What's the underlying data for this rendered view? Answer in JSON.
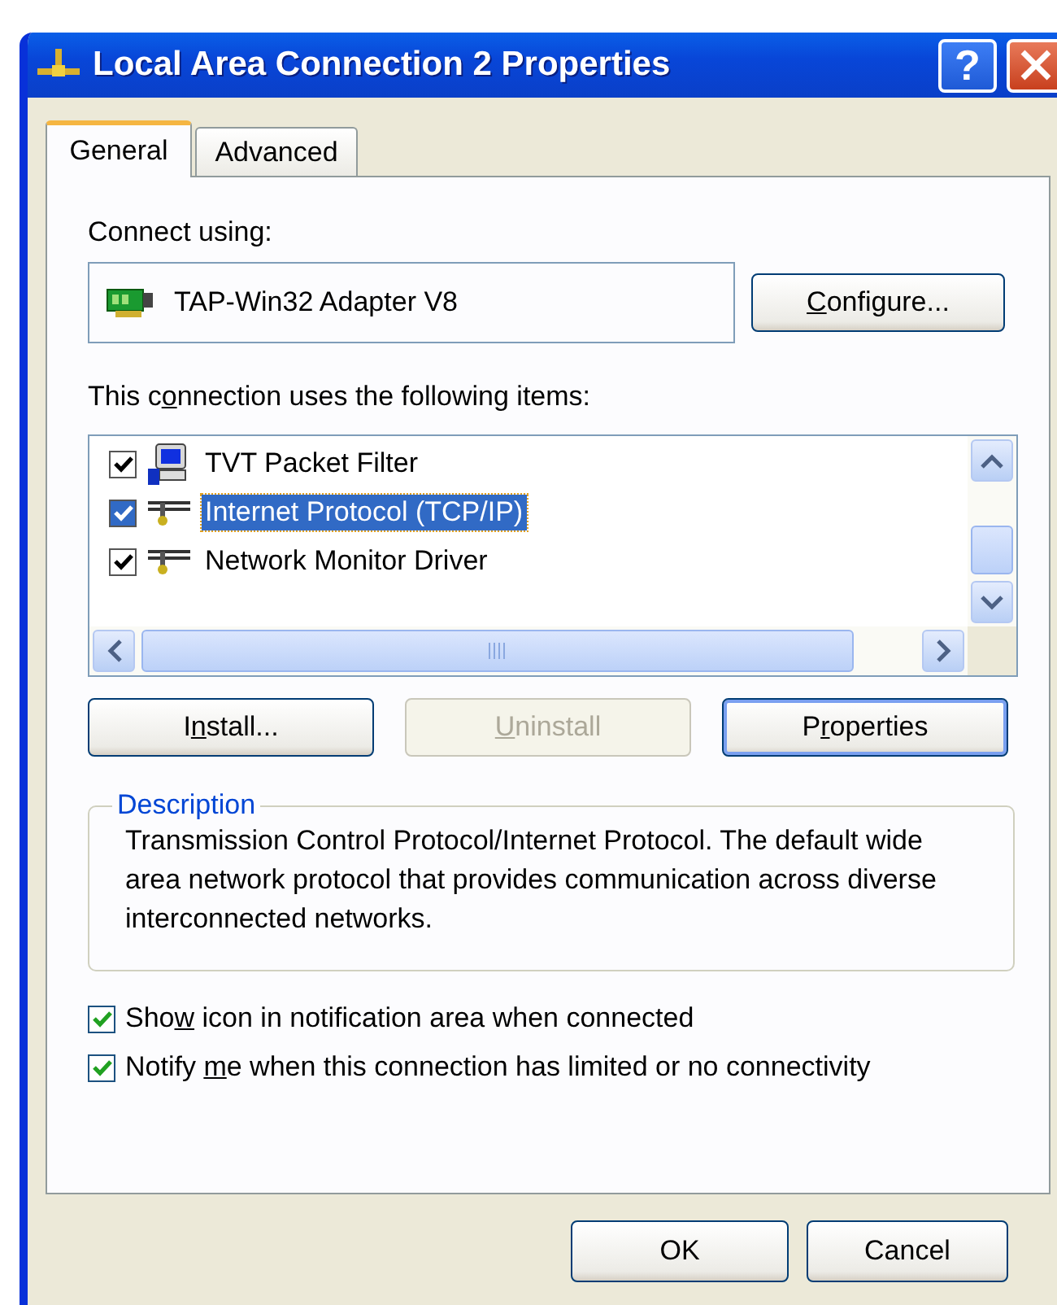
{
  "window": {
    "title": "Local Area Connection 2 Properties",
    "help_button": "?"
  },
  "tabs": [
    {
      "label": "General",
      "selected": true
    },
    {
      "label": "Advanced",
      "selected": false
    }
  ],
  "connect_using": {
    "label": "Connect using:",
    "adapter": "TAP-Win32 Adapter V8",
    "configure_button": {
      "key": "C",
      "after": "onfigure..."
    }
  },
  "items_label": {
    "before": "This c",
    "key": "o",
    "after": "nnection uses the following items:"
  },
  "items": [
    {
      "label": "TVT Packet Filter",
      "kind": "computer",
      "checked": true,
      "selected": false
    },
    {
      "label": "Internet Protocol (TCP/IP)",
      "kind": "protocol",
      "checked": true,
      "selected": true
    },
    {
      "label": "Network Monitor Driver",
      "kind": "protocol",
      "checked": true,
      "selected": false
    }
  ],
  "item_buttons": [
    {
      "before": "I",
      "key": "n",
      "after": "stall...",
      "disabled": false,
      "default": false
    },
    {
      "key": "U",
      "after": "ninstall",
      "disabled": true,
      "default": false
    },
    {
      "before": "P",
      "key": "r",
      "after": "operties",
      "disabled": false,
      "default": true
    }
  ],
  "description": {
    "title": "Description",
    "text": "Transmission Control Protocol/Internet Protocol. The default wide area network protocol that provides communication across diverse interconnected networks."
  },
  "options": [
    {
      "before": "Sho",
      "key": "w",
      "after": " icon in notification area when connected",
      "checked": true
    },
    {
      "before": "Notify ",
      "key": "m",
      "after": "e when this connection has limited or no connectivity",
      "checked": true
    }
  ],
  "buttons": [
    {
      "label": "OK"
    },
    {
      "label": "Cancel"
    }
  ]
}
